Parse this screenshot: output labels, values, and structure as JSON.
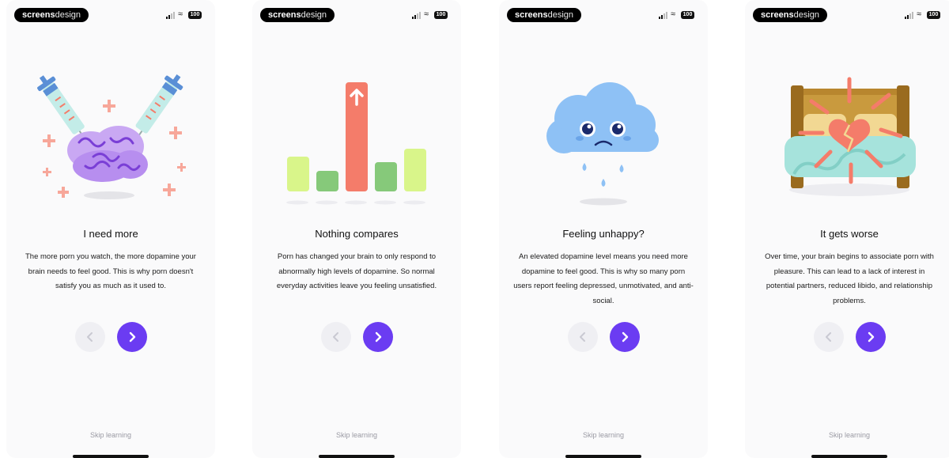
{
  "status_bar": {
    "brand_bold": "screens",
    "brand_light": "design",
    "battery": "100"
  },
  "screens": [
    {
      "title": "I need more",
      "description": "The more porn you watch, the more dopamine your brain needs to feel good. This is why porn doesn't satisfy you as much as it used to.",
      "illustration": "brain-syringes-illustration",
      "skip_label": "Skip learning"
    },
    {
      "title": "Nothing compares",
      "description": "Porn has changed your brain to only respond to abnormally high levels of dopamine. So normal everyday activities leave you feeling unsatisfied.",
      "illustration": "dopamine-bars-illustration",
      "skip_label": "Skip learning"
    },
    {
      "title": "Feeling unhappy?",
      "description": "An elevated dopamine level means you need more dopamine to feel good. This is why so many porn users report feeling depressed, unmotivated, and anti-social.",
      "illustration": "sad-cloud-illustration",
      "skip_label": "Skip learning"
    },
    {
      "title": "It gets worse",
      "description": "Over time, your brain begins to associate porn with pleasure. This can lead to a lack of interest in potential partners, reduced libido, and relationship problems.",
      "illustration": "broken-heart-bed-illustration",
      "skip_label": "Skip learning"
    }
  ],
  "nav": {
    "prev_icon": "chevron-left-icon",
    "next_icon": "chevron-right-icon"
  },
  "colors": {
    "accent": "#6b3cf2",
    "prev_bg": "#efeff3",
    "salmon": "#f47c6a",
    "lime": "#d9f58a",
    "green": "#86c97a",
    "sky": "#8ec1f5",
    "mint": "#a6e3dc"
  }
}
